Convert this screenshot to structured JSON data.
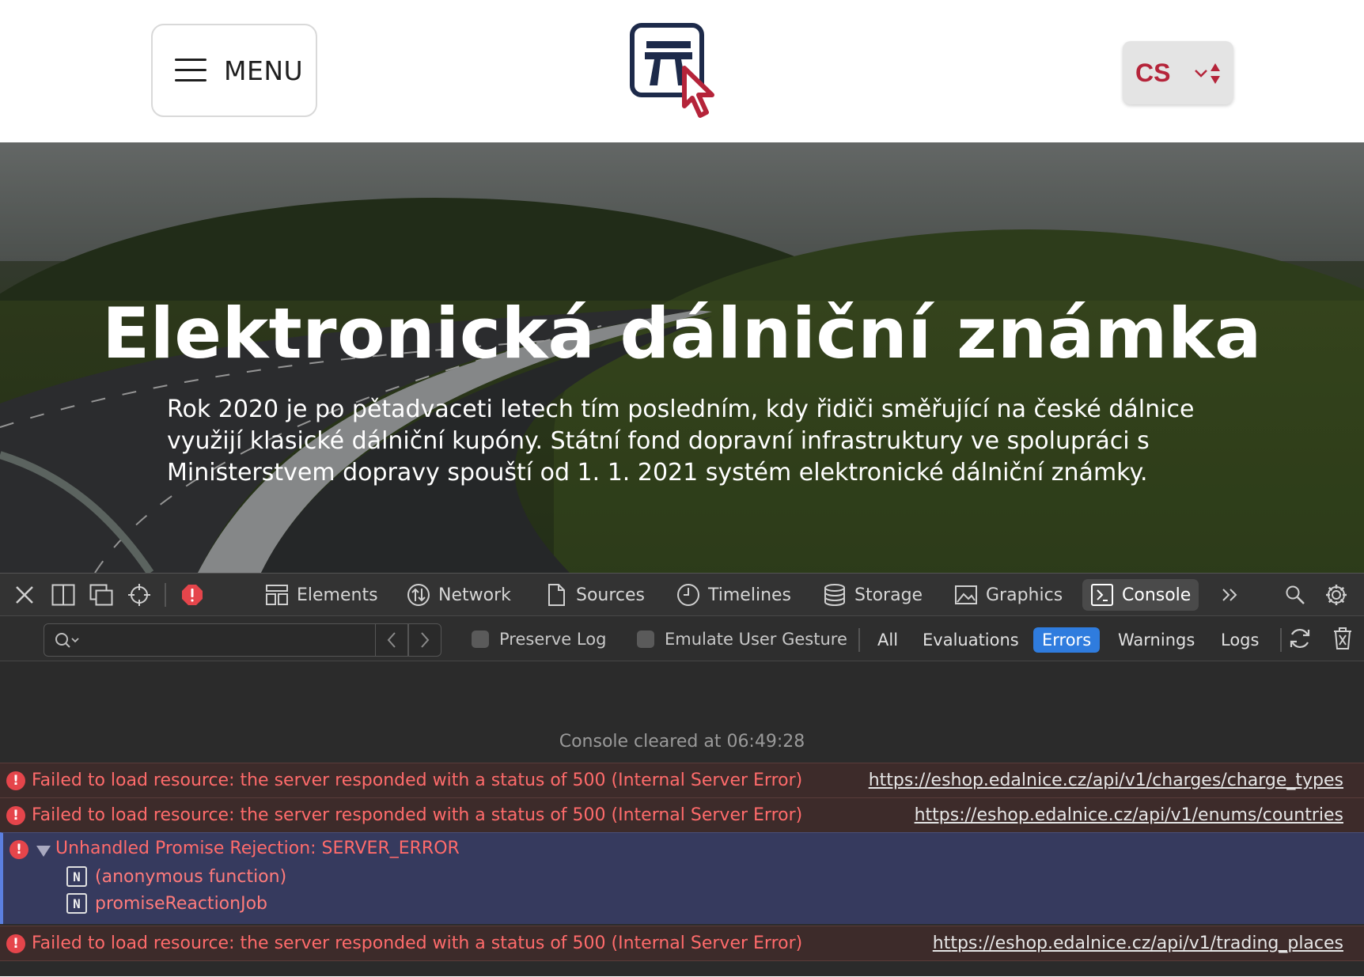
{
  "header": {
    "menu_label": "MENU",
    "language": {
      "selected": "CS"
    },
    "logo_icon": "motorway-sign-cursor-icon",
    "colors": {
      "brand_navy": "#1d2a4a",
      "brand_red": "#b5243a"
    }
  },
  "hero": {
    "title": "Elektronická dálniční známka",
    "paragraph": "Rok 2020 je po pětadvaceti letech tím posledním, kdy řidiči směřující na české dálnice využijí klasické dálniční kupóny. Státní fond dopravní infrastruktury ve spolupráci s Ministerstvem dopravy spouští od 1. 1. 2021 systém elektronické dálniční známky."
  },
  "devtools": {
    "tabs": [
      {
        "label": "Elements",
        "icon": "elements-icon"
      },
      {
        "label": "Network",
        "icon": "network-icon"
      },
      {
        "label": "Sources",
        "icon": "sources-icon"
      },
      {
        "label": "Timelines",
        "icon": "timelines-icon"
      },
      {
        "label": "Storage",
        "icon": "storage-icon"
      },
      {
        "label": "Graphics",
        "icon": "graphics-icon"
      },
      {
        "label": "Console",
        "icon": "console-icon",
        "active": true
      }
    ],
    "filter": {
      "search_placeholder": "",
      "preserve_log": "Preserve Log",
      "emulate_gesture": "Emulate User Gesture",
      "levels": [
        "All",
        "Evaluations",
        "Errors",
        "Warnings",
        "Logs"
      ],
      "active_level": "Errors"
    },
    "console": {
      "cleared": "Console cleared at 06:49:28",
      "messages": [
        {
          "text": "Failed to load resource: the server responded with a status of 500 (Internal Server Error)",
          "link": "https://eshop.edalnice.cz/api/v1/charges/charge_types"
        },
        {
          "text": "Failed to load resource: the server responded with a status of 500 (Internal Server Error)",
          "link": "https://eshop.edalnice.cz/api/v1/enums/countries"
        },
        {
          "text": "Failed to load resource: the server responded with a status of 500 (Internal Server Error)",
          "link": "https://eshop.edalnice.cz/api/v1/trading_places"
        }
      ],
      "promise": {
        "title": "Unhandled Promise Rejection: SERVER_ERROR",
        "badge": "N",
        "frames": [
          "(anonymous function)",
          "promiseReactionJob"
        ]
      },
      "error_glyph": "!"
    },
    "colors": {
      "error_red": "#e5454b",
      "active_blue": "#2f7cde"
    }
  }
}
